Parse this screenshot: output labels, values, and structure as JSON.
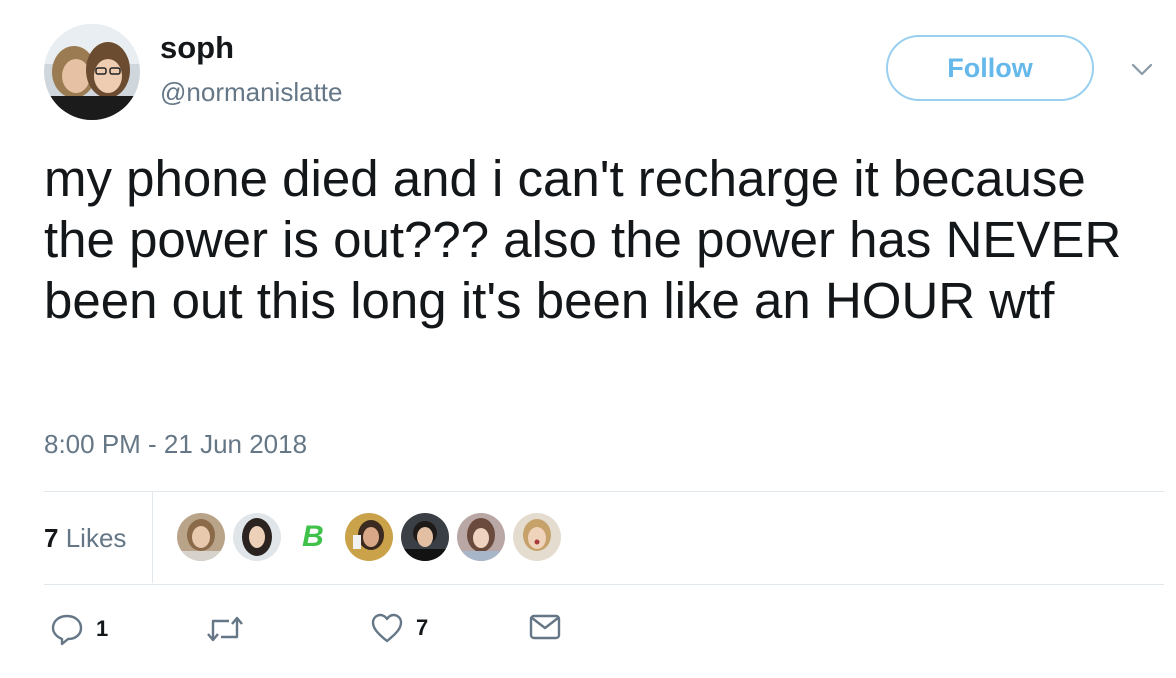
{
  "user": {
    "display_name": "soph",
    "handle": "@normanislatte"
  },
  "follow_button": {
    "label": "Follow"
  },
  "tweet": {
    "text": "my phone died and i can't recharge it because the power is out??? also the power has NEVER been out this long it's been like an HOUR wtf",
    "timestamp": "8:00 PM - 21 Jun 2018"
  },
  "stats": {
    "likes_count": "7",
    "likes_label": "Likes"
  },
  "likers": [
    {
      "name": "liker-avatar-1"
    },
    {
      "name": "liker-avatar-2"
    },
    {
      "name": "liker-avatar-3",
      "glyph": "B"
    },
    {
      "name": "liker-avatar-4"
    },
    {
      "name": "liker-avatar-5"
    },
    {
      "name": "liker-avatar-6"
    },
    {
      "name": "liker-avatar-7"
    }
  ],
  "actions": {
    "reply_count": "1",
    "retweet_count": "",
    "like_count": "7"
  },
  "icons": {
    "reply": "reply-icon",
    "retweet": "retweet-icon",
    "like": "heart-icon",
    "message": "envelope-icon",
    "more": "chevron-down-icon"
  },
  "colors": {
    "accent": "#1da1f2",
    "follow_border": "#9ad0ef",
    "secondary_text": "#657786",
    "divider": "#e1e8ed"
  }
}
